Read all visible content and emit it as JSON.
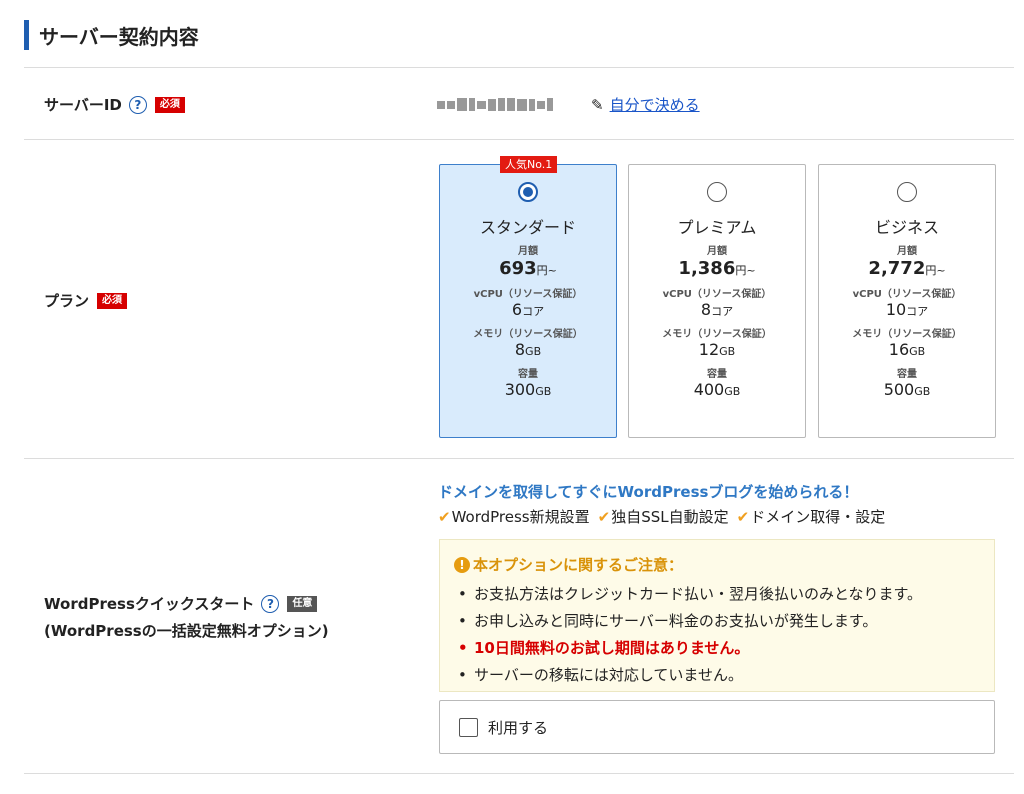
{
  "section_title": "サーバー契約内容",
  "server_id": {
    "label": "サーバーID",
    "help": "?",
    "required": "必須",
    "link_text": "自分で決める"
  },
  "plan": {
    "label": "プラン",
    "required": "必須",
    "price_label": "月額",
    "cpu_label": "vCPU（リソース保証）",
    "mem_label": "メモリ（リソース保証）",
    "disk_label": "容量",
    "price_unit": "円~",
    "cpu_unit": "コア",
    "gb_unit": "GB",
    "cards": [
      {
        "badge": "人気No.1",
        "name": "スタンダード",
        "price": "693",
        "cpu": "6",
        "mem": "8",
        "disk": "300",
        "selected": true
      },
      {
        "badge": "",
        "name": "プレミアム",
        "price": "1,386",
        "cpu": "8",
        "mem": "12",
        "disk": "400",
        "selected": false
      },
      {
        "badge": "",
        "name": "ビジネス",
        "price": "2,772",
        "cpu": "10",
        "mem": "16",
        "disk": "500",
        "selected": false
      }
    ]
  },
  "wp": {
    "label1": "WordPressクイックスタート",
    "help": "?",
    "optional": "任意",
    "label2": "(WordPressの一括設定無料オプション)",
    "heading": "ドメインを取得してすぐにWordPressブログを始められる！",
    "features": [
      "WordPress新規設置",
      "独自SSL自動設定",
      "ドメイン取得・設定"
    ],
    "notice_title": "本オプションに関するご注意：",
    "notice_items": [
      "お支払方法はクレジットカード払い・翌月後払いのみとなります。",
      "お申し込みと同時にサーバー料金のお支払いが発生します。",
      "10日間無料のお試し期間はありません。",
      "サーバーの移転には対応していません。"
    ],
    "use_label": "利用する"
  }
}
